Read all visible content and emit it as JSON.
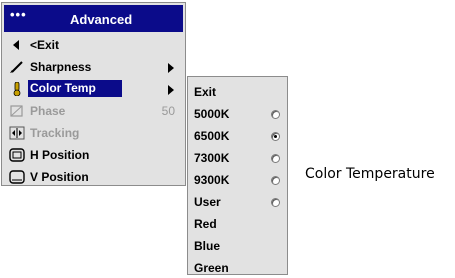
{
  "main_menu": {
    "header_dots": "•••",
    "title": "Advanced",
    "items": [
      {
        "label": "<Exit",
        "icon": "left-arrow-icon"
      },
      {
        "label": "Sharpness",
        "icon": "pencil-icon",
        "has_submenu": true
      },
      {
        "label": "Color Temp",
        "icon": "thermometer-icon",
        "has_submenu": true,
        "selected": true
      },
      {
        "label": "Phase",
        "icon": "phase-icon",
        "value": "50",
        "disabled": true
      },
      {
        "label": "Tracking",
        "icon": "tracking-icon",
        "disabled": true
      },
      {
        "label": "H Position",
        "icon": "monitor-icon"
      },
      {
        "label": "V Position",
        "icon": "monitor-icon"
      }
    ]
  },
  "submenu": {
    "items": [
      {
        "label": "Exit"
      },
      {
        "label": "5000K",
        "radio": true,
        "checked": false
      },
      {
        "label": "6500K",
        "radio": true,
        "checked": true
      },
      {
        "label": "7300K",
        "radio": true,
        "checked": false
      },
      {
        "label": "9300K",
        "radio": true,
        "checked": false
      },
      {
        "label": "User",
        "radio": true,
        "checked": false
      },
      {
        "label": "Red"
      },
      {
        "label": "Blue"
      },
      {
        "label": "Green"
      }
    ]
  },
  "caption": "Color Temperature",
  "colors": {
    "header_bg": "#0b0b8a",
    "menu_bg": "#e2e2e2",
    "disabled_text": "#9a9a9a"
  }
}
